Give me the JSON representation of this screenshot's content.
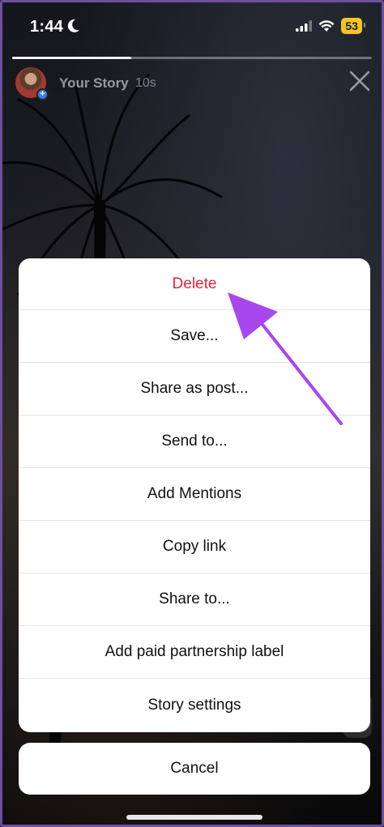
{
  "status_bar": {
    "time": "1:44",
    "battery": "53"
  },
  "story": {
    "name": "Your Story",
    "time_ago": "10s",
    "progress": 0.33
  },
  "menu": {
    "items": [
      {
        "label": "Delete"
      },
      {
        "label": "Save..."
      },
      {
        "label": "Share as post..."
      },
      {
        "label": "Send to..."
      },
      {
        "label": "Add Mentions"
      },
      {
        "label": "Copy link"
      },
      {
        "label": "Share to..."
      },
      {
        "label": "Add paid partnership label"
      },
      {
        "label": "Story settings"
      }
    ],
    "cancel_label": "Cancel"
  },
  "colors": {
    "danger": "#e0263a",
    "annotation_arrow": "#a846f0",
    "battery": "#f3c623"
  },
  "icons": [
    "moon-icon",
    "signal-icon",
    "wifi-icon",
    "battery-icon",
    "close-icon",
    "add-story-icon",
    "annotation-arrow-icon"
  ]
}
